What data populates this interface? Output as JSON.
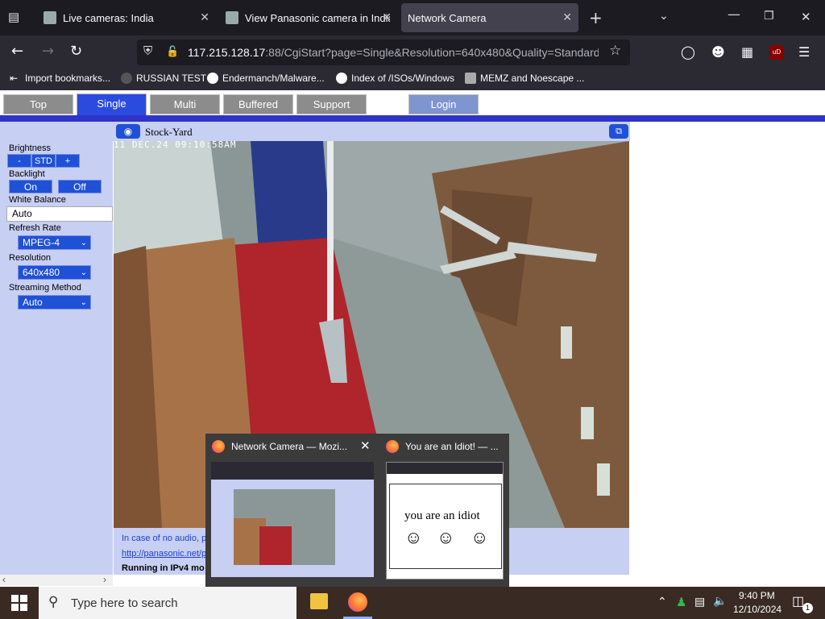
{
  "browser": {
    "tabs": [
      {
        "title": "Live cameras: India",
        "active": false
      },
      {
        "title": "View Panasonic camera in India",
        "active": false
      },
      {
        "title": "Network Camera",
        "active": true
      }
    ],
    "url_host": "117.215.128.17",
    "url_rest": ":88/CgiStart?page=Single&Resolution=640x480&Quality=Standard&",
    "bookmarks": [
      "Import bookmarks...",
      "RUSSIAN TEST",
      "Endermanch/Malware...",
      "Index of /ISOs/Windows",
      "MEMZ and Noescape ..."
    ]
  },
  "page": {
    "nav": [
      "Top",
      "Single",
      "Multi",
      "Buffered Image",
      "Support",
      "Login"
    ],
    "camera_name": "Stock-Yard",
    "timestamp": "11 DEC.24 09:10:58AM",
    "controls": {
      "brightness_label": "Brightness",
      "brightness_minus": "-",
      "brightness_std": "STD",
      "brightness_plus": "+",
      "backlight_label": "Backlight",
      "backlight_on": "On",
      "backlight_off": "Off",
      "white_balance_label": "White Balance",
      "white_balance_value": "Auto",
      "refresh_rate_label": "Refresh Rate",
      "refresh_rate_value": "MPEG-4",
      "resolution_label": "Resolution",
      "resolution_value": "640x480",
      "streaming_label": "Streaming Method",
      "streaming_value": "Auto"
    },
    "below_video": {
      "audio_note": "In case of no audio, pl",
      "link": "http://panasonic.net/p",
      "ipv4_note": "Running in IPv4 mo"
    }
  },
  "thumbnails": [
    {
      "title": "Network Camera — Mozi..."
    },
    {
      "title": "You are an Idiot! — ...",
      "content": "you are an idiot",
      "faces": [
        "☺",
        "☺",
        "☺"
      ]
    }
  ],
  "taskbar": {
    "search_placeholder": "Type here to search",
    "time": "9:40 PM",
    "date": "12/10/2024",
    "notification_count": "1"
  }
}
